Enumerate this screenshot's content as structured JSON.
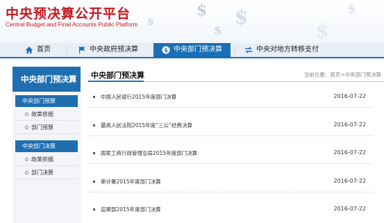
{
  "header": {
    "title": "中央预决算公开平台",
    "subtitle": "Central Budget and Final Accounts Public Platform",
    "decor_glyphs": [
      "$",
      "$",
      "$",
      "$",
      "$",
      "$"
    ]
  },
  "nav": {
    "items": [
      {
        "label": "首页",
        "icon": "home-icon"
      },
      {
        "label": "中央政府预决算",
        "icon": "flag-icon"
      },
      {
        "label": "中央部门预决算",
        "icon": "dollar-coin-icon",
        "active": true
      },
      {
        "label": "中央对地方转移支付",
        "icon": "exchange-icon"
      }
    ]
  },
  "sidebar": {
    "heading": "中央部门预决算",
    "groups": [
      {
        "label": "中央部门预算",
        "items": [
          "政策依据",
          "部门预算"
        ]
      },
      {
        "label": "中央部门决算",
        "items": [
          "政策依据",
          "部门决算"
        ]
      }
    ]
  },
  "main": {
    "title": "中央部门预决算",
    "breadcrumb": "当前位置：首页>中央部门预决算",
    "rows": [
      {
        "title": "中国人民银行2015年度部门决算",
        "date": "2016-07-22"
      },
      {
        "title": "最高人民法院2015年度“三公”经费决算",
        "date": "2016-07-22"
      },
      {
        "title": "国家工商行政管理总局2015年度部门决算",
        "date": "2016-07-22"
      },
      {
        "title": "审计署2015年度部门决算",
        "date": "2016-07-22"
      },
      {
        "title": "监察部2015年度部门决算",
        "date": "2016-07-22"
      }
    ]
  },
  "colors": {
    "brand_red": "#c8161d",
    "nav_blue": "#1a6fb5",
    "sidebar_blue": "#1f6fb0"
  }
}
